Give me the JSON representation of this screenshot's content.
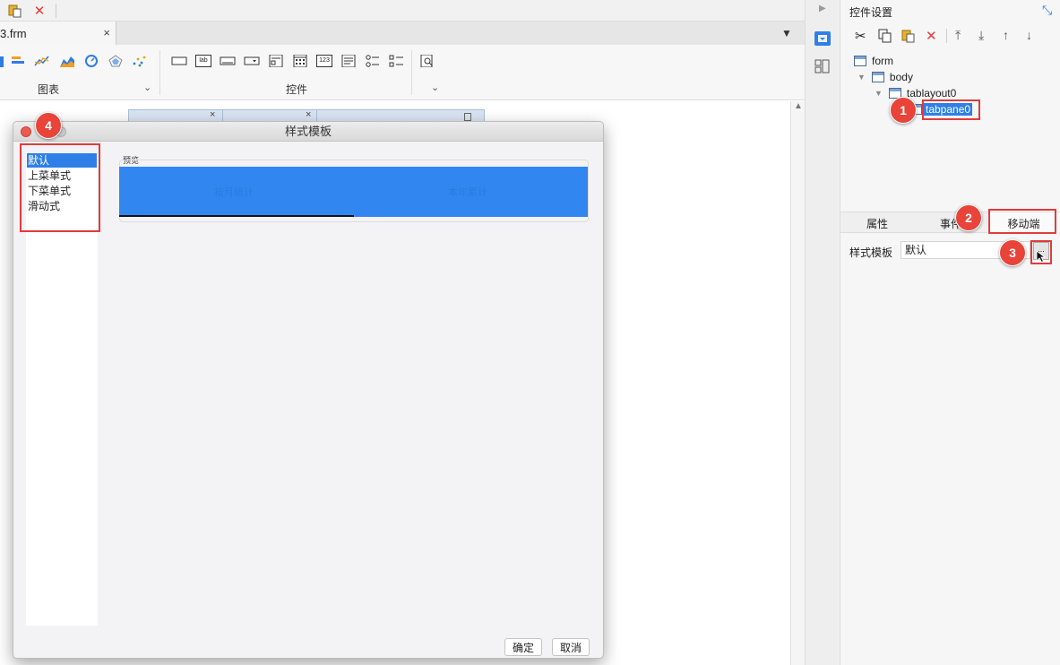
{
  "toolbar": {
    "paste_icon": "paste-icon",
    "delete_icon": "close-icon"
  },
  "file_tab": {
    "name": "3.frm",
    "close": "×"
  },
  "ribbon": {
    "chart_group_label": "图表",
    "widget_group_label": "控件",
    "widget_text_icon": "lab",
    "widget_number_icon": "123"
  },
  "canvas": {
    "tabs": [
      {
        "close": "×"
      },
      {
        "close": "×"
      }
    ]
  },
  "right_panel": {
    "title": "控件设置",
    "tree": [
      {
        "label": "form"
      },
      {
        "label": "body"
      },
      {
        "label": "tablayout0"
      },
      {
        "label": "tabpane0"
      }
    ],
    "tabs": [
      "属性",
      "事件",
      "移动端"
    ],
    "style_template_label": "样式模板",
    "style_template_value": "默认",
    "ellipsis": "..."
  },
  "dialog": {
    "title": "样式模板",
    "styles": [
      "默认",
      "上菜单式",
      "下菜单式",
      "滑动式"
    ],
    "selected": "默认",
    "preview_label": "预览",
    "preview_tabs": [
      "按月统计",
      "本年累计"
    ],
    "ok": "确定",
    "cancel": "取消"
  },
  "annotations": [
    "1",
    "2",
    "3",
    "4"
  ],
  "colors": {
    "accent": "#3286f0",
    "annotation": "#e8443a",
    "selection": "#2f7fe8"
  }
}
